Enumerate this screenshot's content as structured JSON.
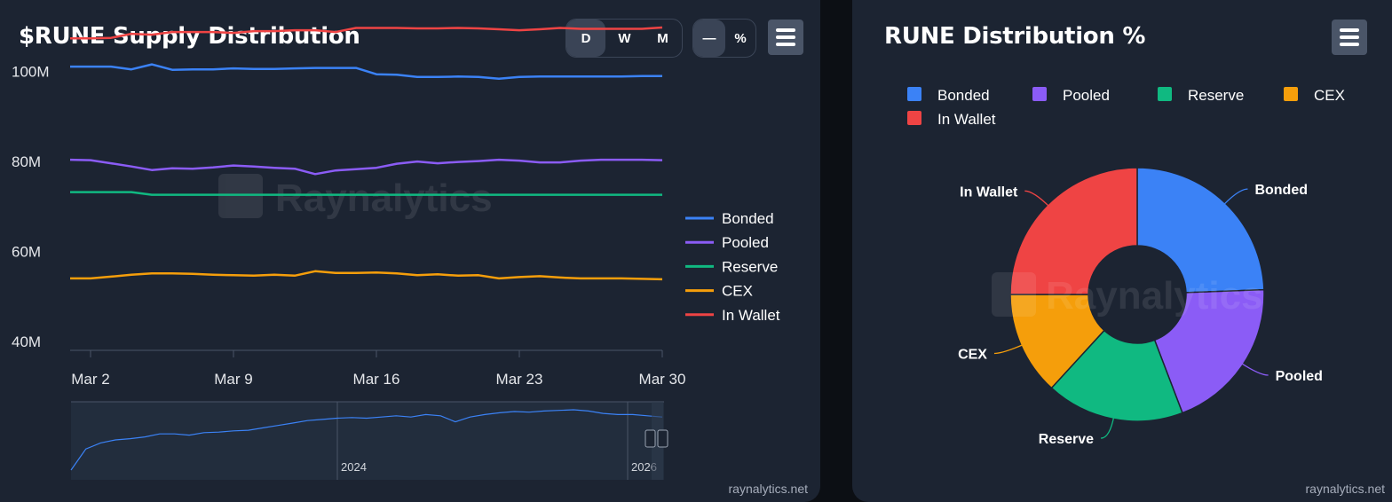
{
  "left": {
    "title": "$RUNE Supply Distribution",
    "range_buttons": [
      "D",
      "W",
      "M"
    ],
    "active_range": "D",
    "mode_buttons": [
      "—",
      "%"
    ],
    "footer": "raynalytics.net",
    "watermark": "Raynalytics",
    "navigator_labels": [
      "2024",
      "2026"
    ]
  },
  "right": {
    "title": "RUNE Distribution %",
    "footer": "raynalytics.net",
    "watermark": "Raynalytics"
  },
  "icons": {
    "menu": "hamburger-menu-icon",
    "logo": "raynalytics-logo-icon"
  },
  "chart_data": [
    {
      "type": "line",
      "title": "$RUNE Supply Distribution",
      "x": [
        "Mar 1",
        "Mar 2",
        "Mar 3",
        "Mar 4",
        "Mar 5",
        "Mar 6",
        "Mar 7",
        "Mar 8",
        "Mar 9",
        "Mar 10",
        "Mar 11",
        "Mar 12",
        "Mar 13",
        "Mar 14",
        "Mar 15",
        "Mar 16",
        "Mar 17",
        "Mar 18",
        "Mar 19",
        "Mar 20",
        "Mar 21",
        "Mar 22",
        "Mar 23",
        "Mar 24",
        "Mar 25",
        "Mar 26",
        "Mar 27",
        "Mar 28",
        "Mar 29",
        "Mar 30"
      ],
      "x_ticks": [
        "Mar 2",
        "Mar 9",
        "Mar 16",
        "Mar 23",
        "Mar 30"
      ],
      "y_ticks": [
        "40M",
        "60M",
        "80M",
        "100M"
      ],
      "ylim": [
        38,
        110
      ],
      "grid": false,
      "legend_position": "right",
      "series": [
        {
          "name": "Bonded",
          "color": "#3b82f6",
          "values": [
            101.1,
            101.1,
            101.1,
            100.5,
            101.6,
            100.4,
            100.5,
            100.5,
            100.7,
            100.6,
            100.6,
            100.7,
            100.8,
            100.8,
            100.8,
            99.4,
            99.3,
            98.8,
            98.8,
            98.9,
            98.8,
            98.4,
            98.8,
            98.9,
            98.9,
            98.9,
            98.9,
            98.9,
            99.0,
            99.0
          ]
        },
        {
          "name": "Pooled",
          "color": "#8b5cf6",
          "values": [
            80.4,
            80.3,
            79.6,
            78.9,
            78.1,
            78.5,
            78.4,
            78.7,
            79.1,
            78.9,
            78.6,
            78.4,
            77.2,
            78.0,
            78.3,
            78.6,
            79.5,
            80.0,
            79.6,
            79.9,
            80.1,
            80.4,
            80.2,
            79.8,
            79.8,
            80.2,
            80.4,
            80.4,
            80.4,
            80.3
          ]
        },
        {
          "name": "Reserve",
          "color": "#10b981",
          "values": [
            73.2,
            73.2,
            73.2,
            73.2,
            72.6,
            72.6,
            72.6,
            72.6,
            72.6,
            72.6,
            72.6,
            72.6,
            72.6,
            72.6,
            72.6,
            72.6,
            72.6,
            72.6,
            72.6,
            72.6,
            72.6,
            72.6,
            72.6,
            72.6,
            72.6,
            72.6,
            72.6,
            72.6,
            72.6,
            72.6
          ]
        },
        {
          "name": "CEX",
          "color": "#f59e0b",
          "values": [
            54.0,
            54.0,
            54.4,
            54.8,
            55.1,
            55.1,
            55.0,
            54.8,
            54.7,
            54.6,
            54.8,
            54.6,
            55.6,
            55.2,
            55.2,
            55.3,
            55.1,
            54.7,
            54.9,
            54.6,
            54.7,
            54.0,
            54.3,
            54.5,
            54.2,
            54.0,
            54.0,
            54.0,
            53.9,
            53.8
          ]
        },
        {
          "name": "In Wallet",
          "color": "#ef4444",
          "values": [
            107.4,
            107.4,
            107.5,
            108.4,
            108.2,
            108.8,
            108.8,
            108.8,
            108.6,
            109.0,
            109.0,
            109.2,
            109.2,
            108.8,
            109.7,
            109.7,
            109.7,
            109.6,
            109.6,
            109.7,
            109.6,
            109.4,
            109.2,
            109.4,
            109.7,
            109.5,
            109.5,
            109.5,
            109.5,
            109.8
          ]
        }
      ]
    },
    {
      "type": "pie",
      "title": "RUNE Distribution %",
      "donut": true,
      "legend_position": "top",
      "categories": [
        "Bonded",
        "Pooled",
        "Reserve",
        "CEX",
        "In Wallet"
      ],
      "values": [
        24.4,
        19.8,
        17.6,
        13.2,
        25.0
      ],
      "colors": [
        "#3b82f6",
        "#8b5cf6",
        "#10b981",
        "#f59e0b",
        "#ef4444"
      ]
    }
  ]
}
